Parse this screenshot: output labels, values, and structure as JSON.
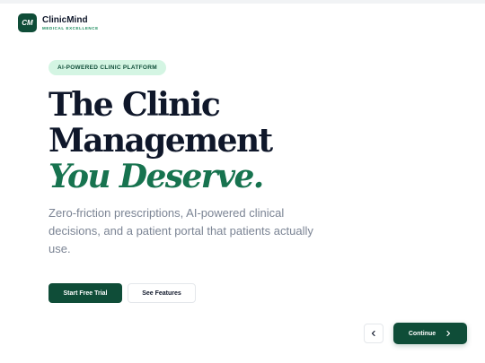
{
  "brand": {
    "logo_text": "CM",
    "name": "ClinicMind",
    "tagline": "MEDICAL EXCELLENCE"
  },
  "hero": {
    "badge": "AI-POWERED CLINIC PLATFORM",
    "headline_line1": "The Clinic",
    "headline_line2": "Management",
    "headline_accent": "You Deserve.",
    "description": "Zero-friction prescriptions, AI-powered clinical decisions, and a patient portal that patients actually use."
  },
  "actions": {
    "primary_label": "Start Free Trial",
    "secondary_label": "See Features"
  },
  "navigation": {
    "back_icon": "chevron-left-icon",
    "continue_label": "Continue",
    "continue_icon": "chevron-right-icon"
  },
  "colors": {
    "primary": "#0f4d38",
    "accent": "#17734f",
    "badge_bg": "#d4f5e3",
    "text_muted": "#7b8494"
  }
}
